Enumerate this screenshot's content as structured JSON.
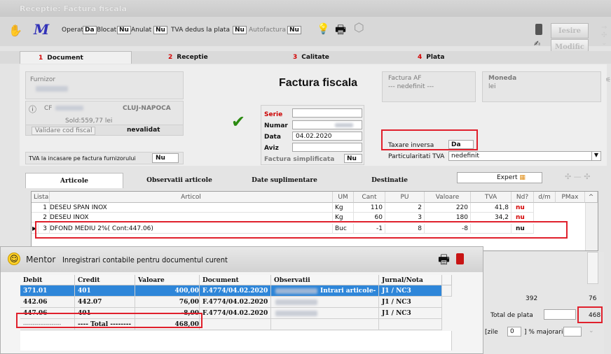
{
  "window": {
    "title": "Receptie: Factura fiscala"
  },
  "toolbar": {
    "operat_label": "Operat",
    "operat_value": "Da",
    "blocat_label": "Blocat",
    "blocat_value": "Nu",
    "anulat_label": "Anulat",
    "anulat_value": "Nu",
    "tva_dedus_label": "TVA dedus la plata",
    "tva_dedus_value": "Nu",
    "autofactura_label": "Autofactura",
    "autofactura_value": "Nu",
    "iesire_label": "Iesire",
    "modific_label": "Modific"
  },
  "tabs": [
    {
      "num": "1",
      "label": "Document"
    },
    {
      "num": "2",
      "label": "Receptie"
    },
    {
      "num": "3",
      "label": "Calitate"
    },
    {
      "num": "4",
      "label": "Plata"
    }
  ],
  "document": {
    "furnizor_label": "Furnizor",
    "cf_label": "CF",
    "city": "CLUJ-NAPOCA",
    "sold": "Sold:559,77 lei",
    "validare_label": "Validare cod fiscal",
    "validare_value": "nevalidat",
    "tva_incasare_label": "TVA la incasare pe factura furnizorului",
    "tva_incasare_value": "Nu",
    "title": "Factura fiscala",
    "serie_label": "Serie",
    "numar_label": "Numar",
    "data_label": "Data",
    "data_value": "04.02.2020",
    "aviz_label": "Aviz",
    "simplificata_label": "Factura simplificata",
    "simplificata_value": "Nu",
    "factura_af_label": "Factura AF",
    "factura_af_value": "--- nedefinit ---",
    "moneda_label": "Moneda",
    "moneda_value": "lei",
    "taxare_label": "Taxare inversa",
    "taxare_value": "Da",
    "particularitati_label": "Particularitati TVA",
    "particularitati_value": "nedefinit"
  },
  "grid_tabs": [
    "Articole",
    "Observatii articole",
    "Date suplimentare",
    "Destinatie"
  ],
  "expert_label": "Expert",
  "grid": {
    "headers": [
      "Lista",
      "Articol",
      "UM",
      "Cant",
      "PU",
      "Valoare",
      "TVA",
      "Nd?",
      "d/m",
      "PMax"
    ],
    "rows": [
      {
        "idx": "1",
        "articol": "DESEU SPAN INOX",
        "um": "Kg",
        "cant": "110",
        "pu": "2",
        "valoare": "220",
        "tva": "41,8",
        "nd": "nu"
      },
      {
        "idx": "2",
        "articol": "DESEU INOX",
        "um": "Kg",
        "cant": "60",
        "pu": "3",
        "valoare": "180",
        "tva": "34,2",
        "nd": "nu"
      },
      {
        "idx": "3",
        "articol": "DFOND MEDIU 2%( Cont:447.06)",
        "um": "Buc",
        "cant": "-1",
        "pu": "8",
        "valoare": "-8",
        "tva": "",
        "nd": "nu"
      }
    ]
  },
  "totals": {
    "valoare": "392",
    "tva": "76",
    "total_label": "Total de plata",
    "total_value": "468",
    "zile_label": "[zile",
    "zile_value": "0",
    "majorari_label": "] % majorari"
  },
  "mentor": {
    "app": "Mentor",
    "title": "Inregistrari contabile pentru documentul curent",
    "headers": [
      "Debit",
      "Credit",
      "Valoare",
      "Document",
      "Observatii",
      "Jurnal/Nota"
    ],
    "rows": [
      {
        "debit": "371.01",
        "credit": "401",
        "valoare": "400,00",
        "document": "F.4774/04.02.2020",
        "obs": "Intrari articole-",
        "jurnal": "J1 / NC3"
      },
      {
        "debit": "442.06",
        "credit": "442.07",
        "valoare": "76,00",
        "document": "F.4774/04.02.2020",
        "obs": "",
        "jurnal": "J1 / NC3"
      },
      {
        "debit": "447.06",
        "credit": "401",
        "valoare": "-8,00",
        "document": "F.4774/04.02.2020",
        "obs": "",
        "jurnal": "J1 / NC3"
      }
    ],
    "total_dashes": "--------------------",
    "total_label": "---- Total --------",
    "total_value": "468,00"
  }
}
